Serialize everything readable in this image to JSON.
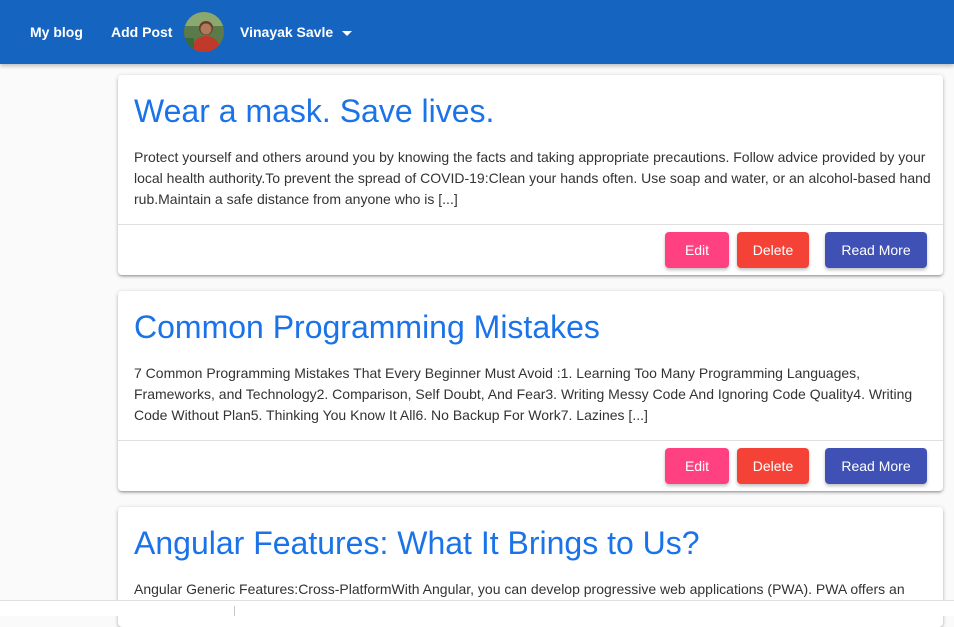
{
  "navbar": {
    "brand": "My blog",
    "add_post": "Add Post",
    "user_name": "Vinayak Savle",
    "color": "#1565c0"
  },
  "posts": [
    {
      "title": "Wear a mask. Save lives.",
      "excerpt": "Protect yourself and others around you by knowing the facts and taking appropriate precautions. Follow advice provided by your local health authority.To prevent the spread of COVID-19:Clean your hands often. Use soap and water, or an alcohol-based hand rub.Maintain a safe distance from anyone who is [...]",
      "edit_label": "Edit",
      "delete_label": "Delete",
      "read_more_label": "Read More"
    },
    {
      "title": "Common Programming Mistakes",
      "excerpt": "7 Common Programming Mistakes That Every Beginner Must Avoid :1. Learning Too Many Programming Languages, Frameworks, and Technology2. Comparison, Self Doubt, And Fear3. Writing Messy Code And Ignoring Code Quality4. Writing Code Without Plan5. Thinking You Know It All6. No Backup For Work7. Lazines [...]",
      "edit_label": "Edit",
      "delete_label": "Delete",
      "read_more_label": "Read More"
    },
    {
      "title": "Angular Features: What It Brings to Us?",
      "excerpt": "Angular Generic Features:Cross-PlatformWith Angular, you can develop progressive web applications (PWA). PWA offers an"
    }
  ],
  "colors": {
    "title": "#1a73e8",
    "edit": "#ff4081",
    "delete": "#f44336",
    "read_more": "#3f51b5"
  },
  "icons": {
    "avatar": "user-avatar",
    "user_menu": "chevron-down-icon"
  }
}
